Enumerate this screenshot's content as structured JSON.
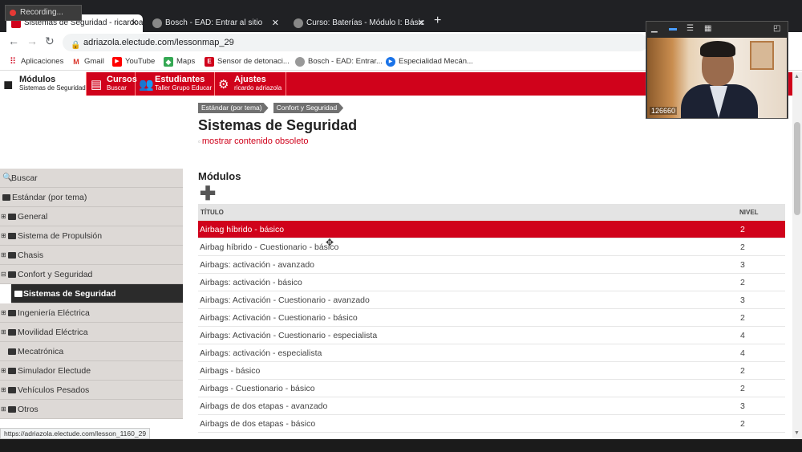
{
  "recording": {
    "label": "Recording..."
  },
  "tabs": [
    {
      "title": "Sistemas de Seguridad - ricardoa",
      "active": true
    },
    {
      "title": "Bosch - EAD: Entrar al sitio",
      "active": false
    },
    {
      "title": "Curso: Baterías - Módulo I: Básic",
      "active": false
    }
  ],
  "address": {
    "url": "adriazola.electude.com/lessonmap_29"
  },
  "bookmarks": [
    {
      "label": "Aplicaciones",
      "icon": "apps-icon"
    },
    {
      "label": "Gmail",
      "icon": "gmail-icon"
    },
    {
      "label": "YouTube",
      "icon": "youtube-icon"
    },
    {
      "label": "Maps",
      "icon": "maps-icon"
    },
    {
      "label": "Sensor de detonaci...",
      "icon": "electude-icon"
    },
    {
      "label": "Bosch - EAD: Entrar...",
      "icon": "bosch-icon"
    },
    {
      "label": "Especialidad Mecán...",
      "icon": "play-icon"
    }
  ],
  "appnav": [
    {
      "title": "Módulos",
      "sub": "Sistemas de Seguridad"
    },
    {
      "title": "Cursos",
      "sub": "Buscar"
    },
    {
      "title": "Estudiantes",
      "sub": "Taller Grupo Educar"
    },
    {
      "title": "Ajustes",
      "sub": "ricardo adriazola"
    }
  ],
  "breadcrumbs": [
    "Estándar (por tema)",
    "Confort y Seguridad"
  ],
  "page": {
    "title": "Sistemas de Seguridad",
    "obsolete_link": "mostrar contenido obsoleto",
    "section_title": "Módulos",
    "add_symbol": "✚"
  },
  "table": {
    "headers": {
      "title": "TÍTULO",
      "level": "NIVEL"
    },
    "rows": [
      {
        "title": "Airbag híbrido - básico",
        "level": "2",
        "active": true
      },
      {
        "title": "Airbag híbrido - Cuestionario - básico",
        "level": "2"
      },
      {
        "title": "Airbags: activación - avanzado",
        "level": "3"
      },
      {
        "title": "Airbags: activación - básico",
        "level": "2"
      },
      {
        "title": "Airbags: Activación - Cuestionario - avanzado",
        "level": "3"
      },
      {
        "title": "Airbags: Activación - Cuestionario - básico",
        "level": "2"
      },
      {
        "title": "Airbags: Activación - Cuestionario - especialista",
        "level": "4"
      },
      {
        "title": "Airbags: activación - especialista",
        "level": "4"
      },
      {
        "title": "Airbags - básico",
        "level": "2"
      },
      {
        "title": "Airbags - Cuestionario - básico",
        "level": "2"
      },
      {
        "title": "Airbags de dos etapas - avanzado",
        "level": "3"
      },
      {
        "title": "Airbags de dos etapas - básico",
        "level": "2"
      }
    ]
  },
  "sidebar": {
    "search_label": "Buscar",
    "root": "Estándar (por tema)",
    "items": [
      {
        "label": "General",
        "expandable": true
      },
      {
        "label": "Sistema de Propulsión",
        "expandable": true
      },
      {
        "label": "Chasis",
        "expandable": true
      },
      {
        "label": "Confort y Seguridad",
        "expandable": true
      },
      {
        "label": "Sistemas de Seguridad",
        "selected": true
      },
      {
        "label": "Ingeniería Eléctrica",
        "expandable": true
      },
      {
        "label": "Movilidad Eléctrica",
        "expandable": true
      },
      {
        "label": "Mecatrónica",
        "expandable": false
      },
      {
        "label": "Simulador Electude",
        "expandable": true
      },
      {
        "label": "Vehículos Pesados",
        "expandable": true
      },
      {
        "label": "Otros",
        "expandable": true
      }
    ]
  },
  "status_url": "https://adriazola.electude.com/lesson_1160_29",
  "webcam": {
    "label": "126660"
  },
  "colors": {
    "brand_red": "#d0021b",
    "sidebar_bg": "#ddd9d6",
    "selected_bg": "#2b2b2b"
  }
}
